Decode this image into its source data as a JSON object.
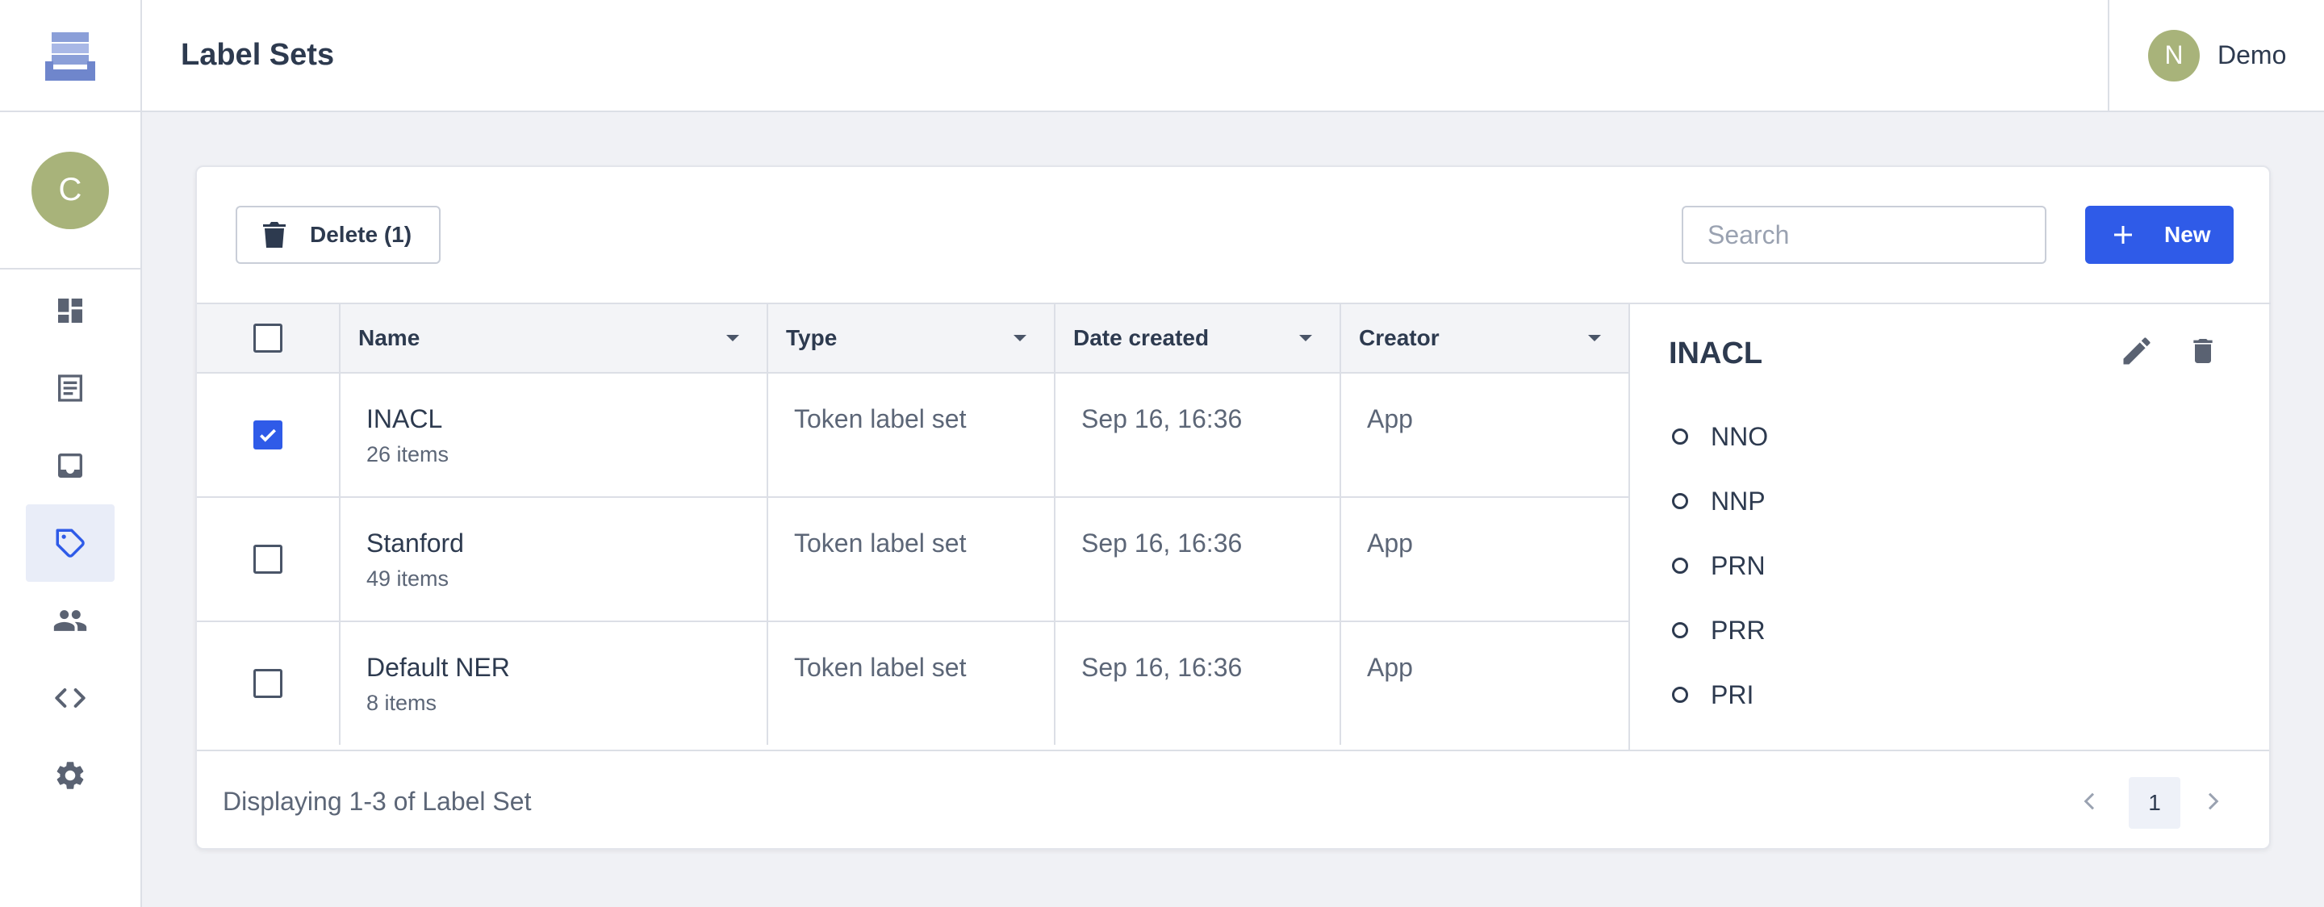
{
  "header": {
    "title": "Label Sets",
    "user_initial": "N",
    "user_name": "Demo"
  },
  "sidebar": {
    "avatar_initial": "C",
    "items": [
      {
        "icon": "dashboard-icon",
        "active": false
      },
      {
        "icon": "document-list-icon",
        "active": false
      },
      {
        "icon": "inbox-icon",
        "active": false
      },
      {
        "icon": "tag-icon",
        "active": true
      },
      {
        "icon": "users-icon",
        "active": false
      },
      {
        "icon": "code-icon",
        "active": false
      },
      {
        "icon": "gear-icon",
        "active": false
      }
    ]
  },
  "toolbar": {
    "delete_label": "Delete (1)",
    "search_placeholder": "Search",
    "new_label": "New"
  },
  "table": {
    "columns": [
      "Name",
      "Type",
      "Date created",
      "Creator"
    ],
    "rows": [
      {
        "name": "INACL",
        "items": "26 items",
        "type": "Token label set",
        "date": "Sep 16, 16:36",
        "creator": "App",
        "checked": true
      },
      {
        "name": "Stanford",
        "items": "49 items",
        "type": "Token label set",
        "date": "Sep 16, 16:36",
        "creator": "App",
        "checked": false
      },
      {
        "name": "Default NER",
        "items": "8 items",
        "type": "Token label set",
        "date": "Sep 16, 16:36",
        "creator": "App",
        "checked": false
      }
    ]
  },
  "detail": {
    "title": "INACL",
    "labels": [
      "NNO",
      "NNP",
      "PRN",
      "PRR",
      "PRI"
    ]
  },
  "footer": {
    "display_text": "Displaying 1-3 of Label Set",
    "current_page": "1"
  },
  "colors": {
    "accent": "#2f5be8",
    "avatar": "#a8b37a",
    "active_nav_bg": "#e9edf8"
  }
}
